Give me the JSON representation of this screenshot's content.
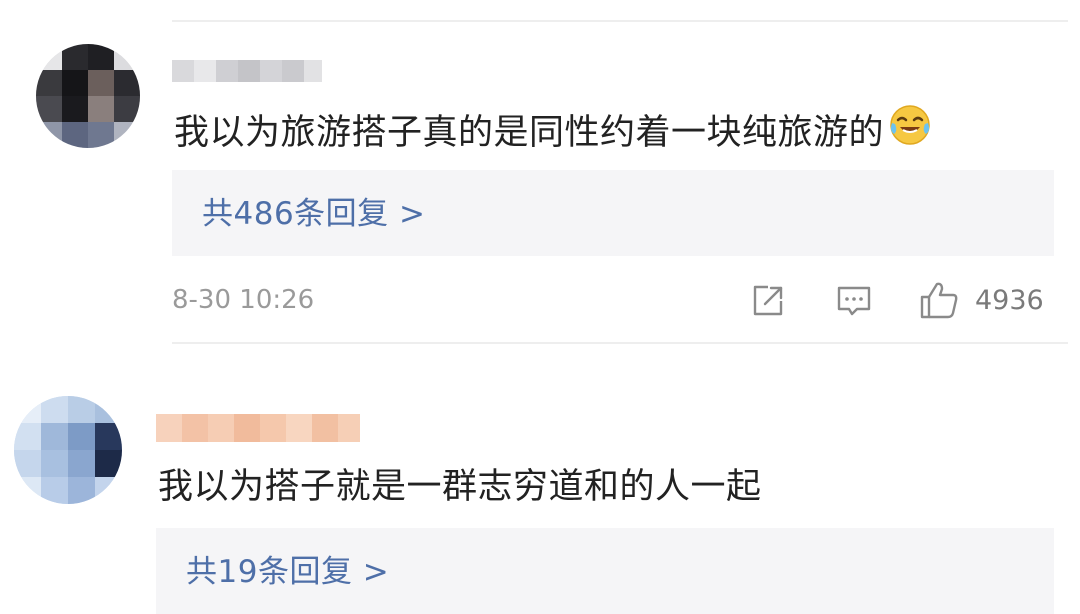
{
  "comments": [
    {
      "text": "我以为旅游搭子真的是同性约着一块纯旅游的",
      "emoji": "laughing-crying-emoji",
      "replies_label": "共486条回复 >",
      "timestamp": "8-30 10:26",
      "like_count": "4936"
    },
    {
      "text": "我以为搭子就是一群志穷道和的人一起",
      "replies_label": "共19条回复 >"
    }
  ],
  "icons": {
    "share": "share-icon",
    "comment": "comment-icon",
    "like": "thumbs-up-icon"
  },
  "colors": {
    "reply_link": "#4e6fa8",
    "reply_box_bg": "#f5f5f7",
    "meta_text": "#9a9a9a",
    "divider": "#eeeeee"
  }
}
